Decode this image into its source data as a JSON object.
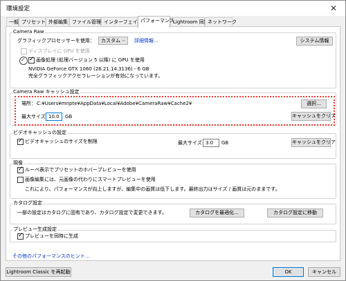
{
  "window": {
    "title": "環境設定",
    "close_glyph": "✕"
  },
  "tabs": [
    {
      "label": "一般"
    },
    {
      "label": "プリセット"
    },
    {
      "label": "外部編集"
    },
    {
      "label": "ファイル管理"
    },
    {
      "label": "インターフェイス"
    },
    {
      "label": "パフォーマンス"
    },
    {
      "label": "Lightroom 同期"
    },
    {
      "label": "ネットワーク"
    }
  ],
  "camera_raw": {
    "title": "Camera Raw",
    "gpu_label": "グラフィックプロセッサーを使用：",
    "gpu_select": "カスタム",
    "detail_link": "詳細情報...",
    "sysinfo_button": "システム情報",
    "display_gpu": "ディスプレイに GPU を使用",
    "image_gpu": "画像処理 (処理バージョン 5 以降) に GPU を使用",
    "gpu_name": "NVIDIA GeForce GTX 1060 (26.21.14.3136) - 6 GB",
    "gpu_status": "完全グラフィックアクセラレーションが有効になっています。"
  },
  "cache": {
    "title": "Camera Raw キャッシュ設定",
    "location_label": "場所：",
    "location_path": "C:¥Users¥mnpte¥AppData¥Local¥Adobe¥CameraRaw¥Cache2¥",
    "choose_button": "選択...",
    "max_size_label": "最大サイズ：",
    "max_size_value": "10.0",
    "unit": "GB",
    "purge_button": "キャッシュをクリア"
  },
  "video_cache": {
    "title": "ビデオキャッシュの設定",
    "limit_label": "ビデオキャッシュのサイズを制限",
    "max_size_label": "最大サイズ：",
    "max_size_value": "3.0",
    "unit": "GB",
    "purge_button": "キャッシュをクリア"
  },
  "history": {
    "title": "現像",
    "loupe_label": "ルーペ表示でプリセットのホバープレビューを使用",
    "smart_label": "画像編集には、元画像の代わりにスマートプレビューを使用",
    "note": "これにより、パフォーマンスが向上しますが、編集中の画質は低下します。最終出力はサイズ / 画質は元のままです。"
  },
  "catalog": {
    "title": "カタログ設定",
    "note": "一部の設定はカタログに固有であり、カタログ設定で変更できます。",
    "optimize_button": "カタログを最適化...",
    "goto_button": "カタログ設定に移動"
  },
  "preview": {
    "title": "プレビュー生成設定",
    "parallel_label": "プレビューを同時に生成"
  },
  "more_tips": "その他のパフォーマンスのヒント...",
  "footer": {
    "restart": "Lightroom Classic を再起動",
    "ok": "OK",
    "cancel": "キャンセル"
  }
}
